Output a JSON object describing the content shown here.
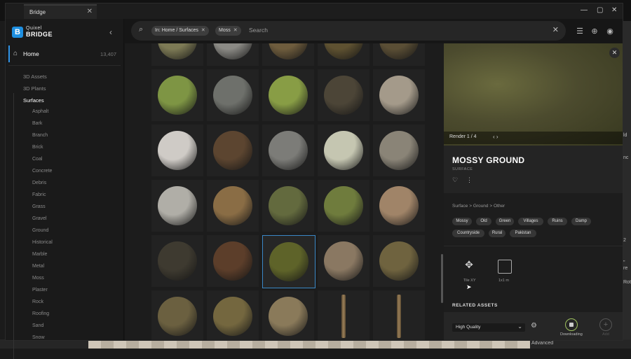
{
  "window": {
    "tab_title": "Bridge",
    "close": "✕"
  },
  "titlebar_controls": [
    "—",
    "▢",
    "✕"
  ],
  "logo": {
    "letter": "B",
    "line1": "Quixel",
    "line2": "BRIDGE"
  },
  "sidebar": {
    "home_label": "Home",
    "home_count": "13,407",
    "categories": [
      "3D Assets",
      "3D Plants",
      "Surfaces"
    ],
    "active_category": "Surfaces",
    "subcategories": [
      "Asphalt",
      "Bark",
      "Branch",
      "Brick",
      "Coal",
      "Concrete",
      "Debris",
      "Fabric",
      "Grass",
      "Gravel",
      "Ground",
      "Historical",
      "Marble",
      "Metal",
      "Moss",
      "Plaster",
      "Rock",
      "Roofing",
      "Sand",
      "Snow"
    ]
  },
  "search": {
    "chips": [
      "In: Home / Surfaces",
      "Moss"
    ],
    "placeholder": "Search"
  },
  "header_icons": [
    "filter-icon",
    "download-icon",
    "account-icon"
  ],
  "colors": {
    "accent": "#2f93e6",
    "selection": "#3a87c6",
    "download_ring": "#9fc25e"
  },
  "grid": {
    "rows": [
      [
        "#7d7a55",
        "#8b8a85",
        "#6e5c3d",
        "#5e5131",
        "#5a4e35"
      ],
      [
        "#7e9544",
        "#6e706b",
        "#889d45",
        "#4c4537",
        "#a49a8a"
      ],
      [
        "#cfcbc6",
        "#5c4530",
        "#7c7c78",
        "#c5c6b1",
        "#8a8477"
      ],
      [
        "#b0aea7",
        "#8a6d45",
        "#636a3e",
        "#6f7c3d",
        "#a08468"
      ],
      [
        "#3e3a30",
        "#5c3e2a",
        "#5e6329",
        "#8a7862",
        "#6f633f"
      ],
      [
        "#6b6040",
        "#74673f",
        "#8a7a5a",
        "stick",
        "stick"
      ]
    ],
    "selected": [
      4,
      2
    ]
  },
  "detail": {
    "render_label": "Render 1 / 4",
    "title": "MOSSY GROUND",
    "type": "SURFACE",
    "breadcrumb": [
      "Surface",
      "Ground",
      "Other"
    ],
    "breadcrumb_sep": ">",
    "tags": [
      "Mossy",
      "Old",
      "Green",
      "Villages",
      "Ruins",
      "Damp",
      "Countryside",
      "Rural",
      "Pakistan"
    ],
    "option1_label": "Tile XY",
    "option2_label": "1x1 m",
    "related_heading": "RELATED ASSETS",
    "quality": "High Quality",
    "download_label": "Downloading",
    "add_label": "Add"
  },
  "host": {
    "advanced": "Advanced",
    "side_texts": [
      "ld",
      "nc",
      "2",
      "\"",
      "re",
      "Rot"
    ]
  }
}
